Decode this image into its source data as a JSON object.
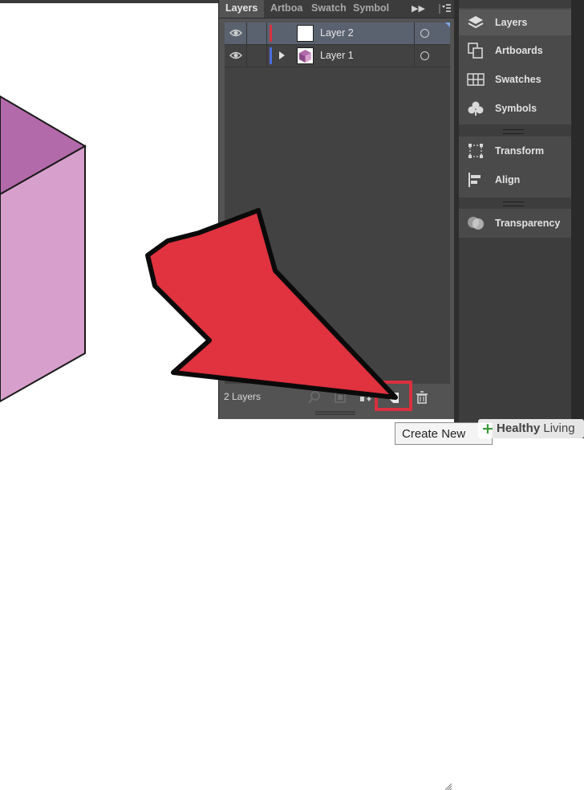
{
  "panel": {
    "tabs": [
      {
        "label": "Layers",
        "active": true
      },
      {
        "label": "Artboa",
        "active": false
      },
      {
        "label": "Swatch",
        "active": false
      },
      {
        "label": "Symbol",
        "active": false
      }
    ],
    "collapse_icon": "double-chevron-right-icon",
    "menu_icon": "panel-menu-icon",
    "layers": [
      {
        "name": "Layer 2",
        "color": "#d9303f",
        "selected": true,
        "expandable": false,
        "thumbnail": "blank"
      },
      {
        "name": "Layer 1",
        "color": "#4a6fe0",
        "selected": false,
        "expandable": true,
        "thumbnail": "purple-cube"
      }
    ],
    "footer": {
      "count_label": "2 Layers",
      "buttons": [
        "locate-object-icon",
        "make-clipping-mask-icon",
        "create-sublayer-icon",
        "create-new-layer-icon",
        "delete-icon"
      ]
    }
  },
  "dock": {
    "groups": [
      {
        "items": [
          {
            "label": "Layers",
            "icon": "layers-icon",
            "active": true
          },
          {
            "label": "Artboards",
            "icon": "artboards-icon",
            "active": false
          },
          {
            "label": "Swatches",
            "icon": "swatches-icon",
            "active": false
          },
          {
            "label": "Symbols",
            "icon": "symbols-icon",
            "active": false
          }
        ]
      },
      {
        "items": [
          {
            "label": "Transform",
            "icon": "transform-icon",
            "active": false
          },
          {
            "label": "Align",
            "icon": "align-icon",
            "active": false
          }
        ]
      },
      {
        "items": [
          {
            "label": "Transparency",
            "icon": "transparency-icon",
            "active": false
          }
        ]
      }
    ]
  },
  "tooltip": {
    "text": "Create New"
  },
  "watermark": {
    "prefix": "+",
    "bold": "Healthy",
    "rest": " Living"
  },
  "colors": {
    "highlight": "#d9303f",
    "arrow": "#e0323f",
    "cube_top": "#b36aaa",
    "cube_side": "#d79fcb"
  }
}
